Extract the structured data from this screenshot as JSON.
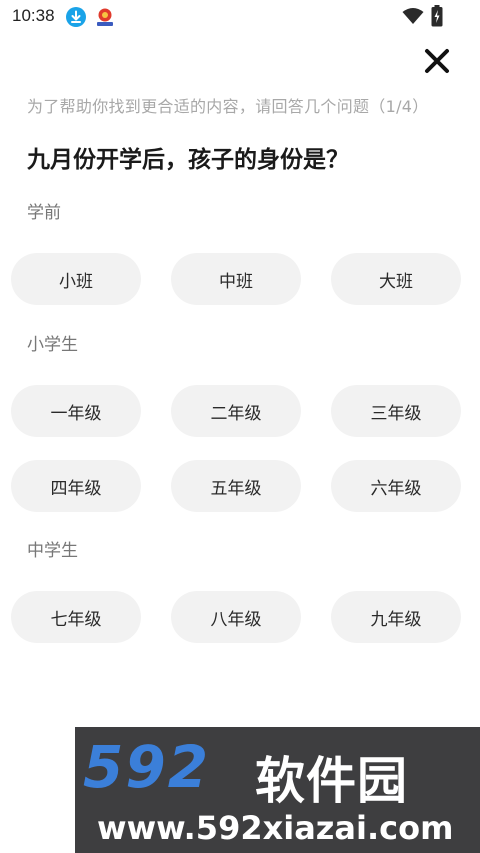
{
  "status_bar": {
    "time": "10:38",
    "icons": [
      "download-icon",
      "app-notification-icon",
      "wifi-icon",
      "battery-charging-icon"
    ]
  },
  "close_icon": "close-icon",
  "progress_hint": "为了帮助你找到更合适的内容，请回答几个问题（1/4）",
  "question": "九月份开学后，孩子的身份是？",
  "sections": [
    {
      "label": "学前",
      "options": [
        "小班",
        "中班",
        "大班"
      ]
    },
    {
      "label": "小学生",
      "options": [
        "一年级",
        "二年级",
        "三年级",
        "四年级",
        "五年级",
        "六年级"
      ]
    },
    {
      "label": "中学生",
      "options": [
        "七年级",
        "八年级",
        "九年级"
      ]
    }
  ],
  "watermark": {
    "number": "592",
    "name": "软件园",
    "url": "www.592xiazai.com"
  },
  "colors": {
    "option_bg": "#f2f2f2",
    "hint": "#a8a8a8",
    "download_badge": "#1aa3e8",
    "watermark_bg": "#3e3e40",
    "watermark_accent": "#3b7fd9"
  }
}
